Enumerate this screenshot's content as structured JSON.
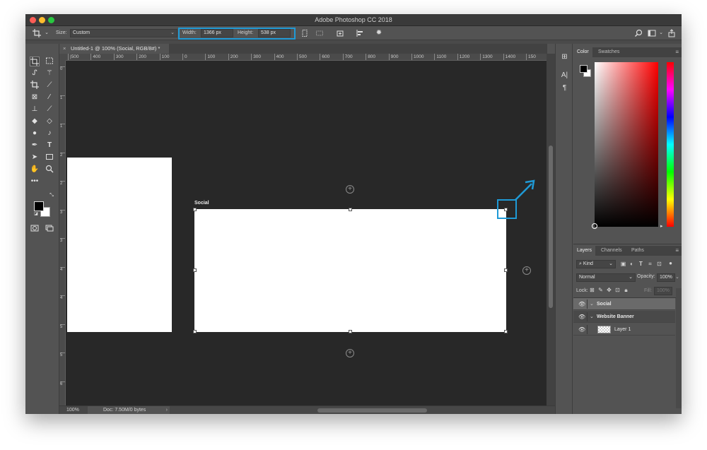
{
  "window": {
    "title": "Adobe Photoshop CC 2018"
  },
  "options_bar": {
    "size_label": "Size:",
    "size_value": "Custom",
    "width_label": "Width:",
    "width_value": "1366 px",
    "height_label": "Height:",
    "height_value": "538 px",
    "highlight_color": "#1f9ad6",
    "icons": [
      "artboard-tool-icon",
      "chevron-down-icon",
      "portrait-orientation-icon",
      "landscape-orientation-icon",
      "add-artboard-icon",
      "align-icon",
      "gear-icon",
      "search-icon",
      "workspace-icon",
      "share-icon"
    ]
  },
  "document": {
    "tab_title": "Untitled-1 @ 100% (Social, RGB/8#) *",
    "close_glyph": "×"
  },
  "rulers": {
    "horizontal": [
      "|500",
      "400",
      "300",
      "200",
      "100",
      "0",
      "100",
      "200",
      "300",
      "400",
      "500",
      "600",
      "700",
      "800",
      "900",
      "1000",
      "1100",
      "1200",
      "1300",
      "1400",
      "150"
    ],
    "vertical": [
      "0",
      "1",
      "1",
      "2",
      "2",
      "3",
      "3",
      "4",
      "4",
      "5",
      "5",
      "6"
    ]
  },
  "canvas": {
    "artboard_label": "Social",
    "add_artboard_glyph": "+"
  },
  "status_bar": {
    "zoom": "100%",
    "doc_info": "Doc: 7.50M/0 bytes",
    "caret": "›"
  },
  "color_panel": {
    "tabs": [
      "Color",
      "Swatches"
    ],
    "foreground": "#000000",
    "background": "#ffffff",
    "hue": "#ff0000"
  },
  "layers_panel": {
    "tabs": [
      "Layers",
      "Channels",
      "Paths"
    ],
    "filter_label": "Kind",
    "blend_mode": "Normal",
    "opacity_label": "Opacity:",
    "opacity_value": "100%",
    "lock_label": "Lock:",
    "fill_label": "Fill:",
    "fill_value": "100%",
    "layers": [
      {
        "name": "Social",
        "type": "artboard",
        "selected": true
      },
      {
        "name": "Website Banner",
        "type": "artboard",
        "selected": false
      },
      {
        "name": "Layer 1",
        "type": "pixel",
        "selected": false
      }
    ]
  }
}
